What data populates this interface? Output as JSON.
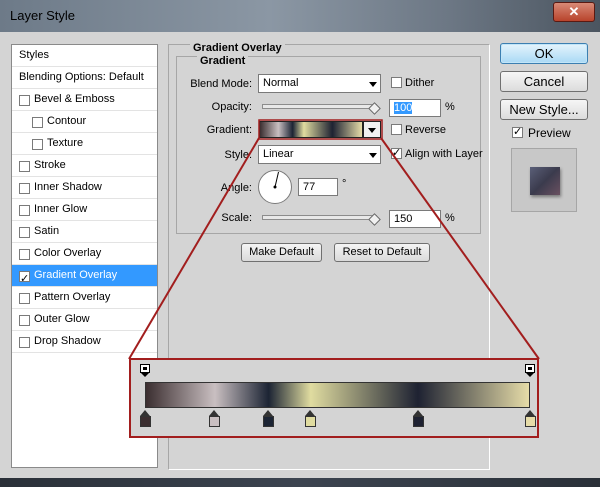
{
  "window": {
    "title": "Layer Style",
    "close_glyph": "✕"
  },
  "styles_panel": {
    "items": [
      {
        "label": "Styles",
        "type": "header"
      },
      {
        "label": "Blending Options: Default",
        "type": "header"
      },
      {
        "label": "Bevel & Emboss",
        "checked": false,
        "indent": false
      },
      {
        "label": "Contour",
        "checked": false,
        "indent": true
      },
      {
        "label": "Texture",
        "checked": false,
        "indent": true
      },
      {
        "label": "Stroke",
        "checked": false,
        "indent": false
      },
      {
        "label": "Inner Shadow",
        "checked": false,
        "indent": false
      },
      {
        "label": "Inner Glow",
        "checked": false,
        "indent": false
      },
      {
        "label": "Satin",
        "checked": false,
        "indent": false
      },
      {
        "label": "Color Overlay",
        "checked": false,
        "indent": false
      },
      {
        "label": "Gradient Overlay",
        "checked": true,
        "indent": false,
        "selected": true
      },
      {
        "label": "Pattern Overlay",
        "checked": false,
        "indent": false
      },
      {
        "label": "Outer Glow",
        "checked": false,
        "indent": false
      },
      {
        "label": "Drop Shadow",
        "checked": false,
        "indent": false
      }
    ]
  },
  "gradient_overlay": {
    "title": "Gradient Overlay",
    "subtitle": "Gradient",
    "blend_mode_label": "Blend Mode:",
    "blend_mode_value": "Normal",
    "dither_label": "Dither",
    "dither_checked": false,
    "opacity_label": "Opacity:",
    "opacity_value": "100",
    "opacity_unit": "%",
    "gradient_label": "Gradient:",
    "reverse_label": "Reverse",
    "reverse_checked": false,
    "style_label": "Style:",
    "style_value": "Linear",
    "align_label": "Align with Layer",
    "align_checked": true,
    "angle_label": "Angle:",
    "angle_value": "77",
    "angle_unit": "°",
    "scale_label": "Scale:",
    "scale_value": "150",
    "scale_unit": "%",
    "make_default_label": "Make Default",
    "reset_default_label": "Reset to Default"
  },
  "right_buttons": {
    "ok_label": "OK",
    "cancel_label": "Cancel",
    "new_style_label": "New Style...",
    "preview_label": "Preview",
    "preview_checked": true
  },
  "gradient": {
    "colors": [
      "#3b2e30",
      "#c9bfc1",
      "#1c2434",
      "#e0dca0",
      "#1e2232",
      "#e6dca8"
    ],
    "color_stop_fractions": [
      0.0,
      0.18,
      0.32,
      0.43,
      0.71,
      1.0
    ],
    "opacity_stop_fractions": [
      0.0,
      1.0
    ]
  }
}
